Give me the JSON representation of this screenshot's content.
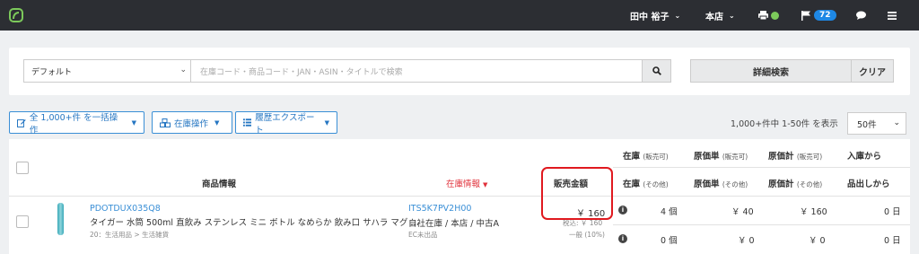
{
  "topbar": {
    "user_name": "田中 裕子",
    "store": "本店",
    "notification_count": "72"
  },
  "search": {
    "preset": "デフォルト",
    "placeholder": "在庫コード・商品コード・JAN・ASIN・タイトルで検索",
    "detail_label": "詳細検索",
    "clear_label": "クリア"
  },
  "actions": {
    "bulk_label": "全 1,000+件 を一括操作",
    "stock_label": "在庫操作",
    "export_label": "履歴エクスポート",
    "count_info": "1,000+件中 1-50件 を表示",
    "per_page": "50件"
  },
  "table": {
    "headers": {
      "product_info": "商品情報",
      "stock_info": "在庫情報",
      "sale_amount": "販売金額",
      "stock": "在庫",
      "stock_sellable": "(販売可)",
      "stock_other_label": "在庫",
      "stock_other": "(その他)",
      "unit_cost": "原価単",
      "unit_cost_sellable": "(販売可)",
      "unit_cost_other_label": "原価単",
      "unit_cost_other": "(その他)",
      "total_cost": "原価計",
      "total_cost_sellable": "(販売可)",
      "total_cost_other_label": "原価計",
      "total_cost_other": "(その他)",
      "since_in": "入庫から",
      "since_out": "品出しから"
    },
    "row": {
      "product_code": "PDOTDUX035Q8",
      "product_name": "タイガー 水筒 500ml 直飲み ステンレス ミニ ボトル なめらか 飲み口 サハラ マグ …",
      "category": "20：生活用品 > 生活雑貨",
      "stock_code": "ITS5K7PV2H00",
      "location": "自社在庫 / 本店 / 中古A",
      "ec_status": "EC未出品",
      "price": "￥ 160",
      "tax_inc": "税込: ￥ 160",
      "condition": "一般 (10%)",
      "stock_sellable": "4 個",
      "unit_cost_sellable": "￥ 40",
      "total_cost_sellable": "￥ 160",
      "days_sellable": "0 日",
      "stock_other": "0 個",
      "unit_cost_other": "￥ 0",
      "total_cost_other": "￥ 0",
      "days_other": "0 日"
    }
  },
  "colors": {
    "topbar": "#2c2e33",
    "accent_blue": "#3a8fd6",
    "highlight_red": "#e0191f"
  },
  "icons": [
    "leaf-logo-icon",
    "printer-icon",
    "flag-icon",
    "chat-icon",
    "menu-icon",
    "search-icon",
    "edit-icon",
    "boxes-icon",
    "list-icon",
    "info-icon"
  ]
}
